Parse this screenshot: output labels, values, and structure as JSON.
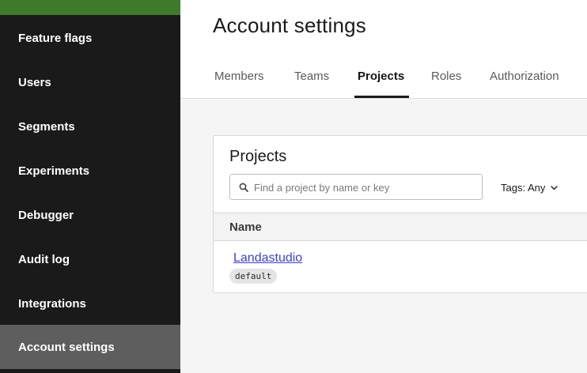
{
  "sidebar": {
    "items": [
      {
        "label": "Feature flags"
      },
      {
        "label": "Users"
      },
      {
        "label": "Segments"
      },
      {
        "label": "Experiments"
      },
      {
        "label": "Debugger"
      },
      {
        "label": "Audit log"
      },
      {
        "label": "Integrations"
      },
      {
        "label": "Account settings"
      }
    ],
    "active_item": "Account settings"
  },
  "header": {
    "title": "Account settings",
    "tabs": [
      {
        "label": "Members"
      },
      {
        "label": "Teams"
      },
      {
        "label": "Projects"
      },
      {
        "label": "Roles"
      },
      {
        "label": "Authorization"
      }
    ],
    "active_tab": "Projects"
  },
  "projects_card": {
    "title": "Projects",
    "search": {
      "placeholder": "Find a project by name or key",
      "value": ""
    },
    "tags_filter": {
      "label": "Tags: Any"
    },
    "table": {
      "columns": [
        "Name"
      ],
      "rows": [
        {
          "name": "Landastudio",
          "tag": "default"
        }
      ]
    }
  },
  "colors": {
    "sidebar_bg": "#1a1a1a",
    "sidebar_accent": "#3d7a2a",
    "sidebar_active_bg": "#5e5e5e",
    "link": "#3b3fcf"
  }
}
